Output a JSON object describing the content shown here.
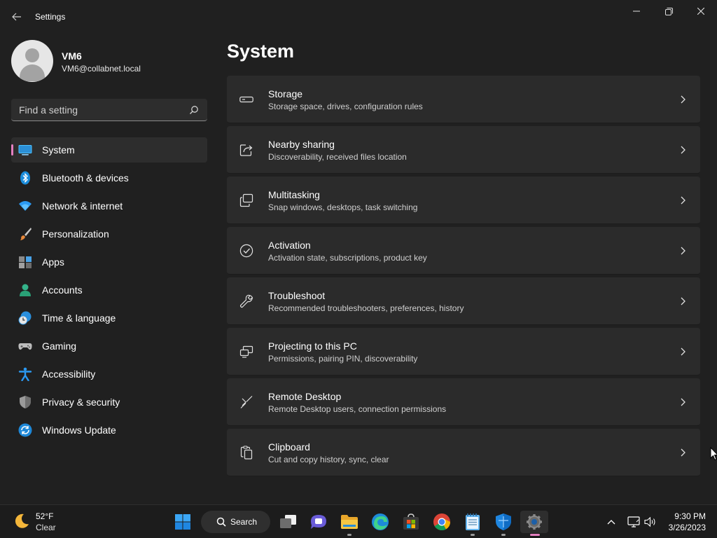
{
  "window": {
    "title": "Settings"
  },
  "profile": {
    "name": "VM6",
    "email": "VM6@collabnet.local"
  },
  "search": {
    "placeholder": "Find a setting"
  },
  "sidebar": {
    "items": [
      {
        "label": "System",
        "icon": "system-display-icon",
        "selected": true
      },
      {
        "label": "Bluetooth & devices",
        "icon": "bluetooth-icon"
      },
      {
        "label": "Network & internet",
        "icon": "wifi-icon"
      },
      {
        "label": "Personalization",
        "icon": "paintbrush-icon"
      },
      {
        "label": "Apps",
        "icon": "apps-icon"
      },
      {
        "label": "Accounts",
        "icon": "accounts-icon"
      },
      {
        "label": "Time & language",
        "icon": "time-language-icon"
      },
      {
        "label": "Gaming",
        "icon": "gamepad-icon"
      },
      {
        "label": "Accessibility",
        "icon": "accessibility-icon"
      },
      {
        "label": "Privacy & security",
        "icon": "shield-icon"
      },
      {
        "label": "Windows Update",
        "icon": "windows-update-icon"
      }
    ]
  },
  "main": {
    "title": "System",
    "cards": [
      {
        "title": "Storage",
        "subtitle": "Storage space, drives, configuration rules",
        "icon": "storage-icon"
      },
      {
        "title": "Nearby sharing",
        "subtitle": "Discoverability, received files location",
        "icon": "share-icon"
      },
      {
        "title": "Multitasking",
        "subtitle": "Snap windows, desktops, task switching",
        "icon": "multitasking-icon"
      },
      {
        "title": "Activation",
        "subtitle": "Activation state, subscriptions, product key",
        "icon": "activation-check-icon"
      },
      {
        "title": "Troubleshoot",
        "subtitle": "Recommended troubleshooters, preferences, history",
        "icon": "wrench-icon"
      },
      {
        "title": "Projecting to this PC",
        "subtitle": "Permissions, pairing PIN, discoverability",
        "icon": "projecting-icon"
      },
      {
        "title": "Remote Desktop",
        "subtitle": "Remote Desktop users, connection permissions",
        "icon": "remote-desktop-icon"
      },
      {
        "title": "Clipboard",
        "subtitle": "Cut and copy history, sync, clear",
        "icon": "clipboard-icon"
      }
    ]
  },
  "taskbar": {
    "weather": {
      "temp": "52°F",
      "condition": "Clear",
      "icon": "moon-icon"
    },
    "search_label": "Search",
    "clock": {
      "time": "9:30 PM",
      "date": "3/26/2023"
    }
  },
  "colors": {
    "accent": "#e37fbf",
    "background": "#202020",
    "card": "#2b2b2b",
    "taskbar": "#1c1c1c"
  }
}
